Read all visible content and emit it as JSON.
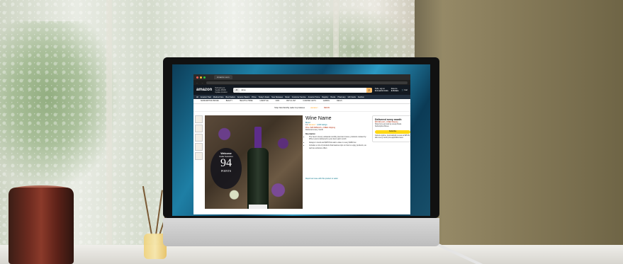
{
  "browser": {
    "tab_title": "Amazon.com",
    "search_category": "All",
    "search_query": "wine"
  },
  "amazon": {
    "logo": "amazon",
    "deliver_to": "Delivering to Seattle 98109",
    "deliver_sub": "Update location",
    "account_line1": "Hello, sign in",
    "account_line2": "Account & Lists",
    "returns_line1": "Returns",
    "returns_line2": "& Orders",
    "cart": "Cart",
    "nav_items": [
      "All",
      "Amazon Haul",
      "Medical Care",
      "Best Sellers",
      "Amazon Basics",
      "Prime",
      "Today's Deals",
      "New Releases",
      "Music",
      "Customer Service",
      "Amazon Home",
      "Registry",
      "Books",
      "Pharmacy",
      "Gift Cards",
      "Fashion"
    ],
    "subnav_items": [
      "SUBSCRIPTION BOXES",
      "BEAUTY",
      "HEALTH & HOME",
      "LIFESTYLE",
      "KIDS",
      "PETS & VET",
      "CURATED GIFTS",
      "GAMING",
      "DEALS"
    ],
    "promo_text": "Shop Now Monthly Ladie Cup Glasses",
    "promo_price": "$99.99"
  },
  "product": {
    "badge_line1": "Welcome",
    "badge_line2": "Cellar Selection",
    "badge_points": "94",
    "badge_label": "POINTS",
    "title": "Wine Name",
    "brand": "Brand",
    "rating_text": "4.2",
    "ratings_count": "4,040 ratings",
    "price_line": "Price: $25.99/Month + FREE shipping",
    "delivery_line": "Delivered every month",
    "description_heading": "Description",
    "bullets": [
      "The best in luxury artisanal monthly premium boxes, products curated by Wine Lovers delivered to your door each month",
      "Always in stock and $25 Pick-sale's value in every $180 box",
      "Includes a mix of products that features tips on how to enjoy products, as well as exclusive offers"
    ],
    "registry_link": "Report an issue with this product or seller"
  },
  "buybox": {
    "title": "Delivered every month",
    "price": "$25.99/month + FREE Shipping",
    "ships_line": "Ships from and sold by Lovely Roots Subscription Boxes",
    "button": "Subscribe",
    "note": "Cancel anytime. Automatically renews at $25.99 after every month plus applicable taxes"
  },
  "colors": {
    "amazon_header": "#131921",
    "amazon_nav": "#232f3e",
    "search_button": "#febd69",
    "subscribe_button": "#ffd814",
    "bottle_foil": "#5d2d8a"
  }
}
